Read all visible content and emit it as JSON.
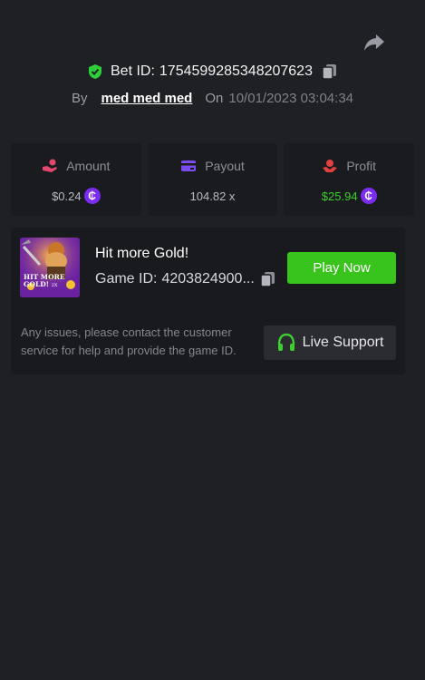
{
  "header": {
    "bet_label": "Bet ID:",
    "bet_id": "1754599285348207623",
    "by_label": "By",
    "username": "med med med",
    "on_label": "On",
    "date": "10/01/2023 03:04:34"
  },
  "stats": [
    {
      "label": "Amount",
      "value": "$0.24",
      "icon": "hand-coin-icon",
      "color": "#e5476f"
    },
    {
      "label": "Payout",
      "value": "104.82 x",
      "icon": "card-icon",
      "color": "#7b4cf0"
    },
    {
      "label": "Profit",
      "value": "$25.94",
      "icon": "hand-money-icon",
      "color": "#e04040"
    }
  ],
  "coin_symbol": "₵",
  "game": {
    "thumbnail_text_line1": "HIT MORE",
    "thumbnail_text_line2": "GOLD!",
    "thumbnail_text_badge": "2X",
    "title": "Hit more Gold!",
    "id_label": "Game ID:",
    "id": "4203824900...",
    "play_label": "Play Now"
  },
  "support": {
    "help_text": "Any issues, please contact the customer service for help and provide the game ID.",
    "button_label": "Live Support"
  },
  "colors": {
    "background": "#1f2024",
    "card": "#1a1b1f",
    "accent_green": "#39c41d",
    "profit_green": "#3bd12c",
    "coin_purple": "#7b2cf0",
    "shield_green": "#2fcf3a"
  }
}
